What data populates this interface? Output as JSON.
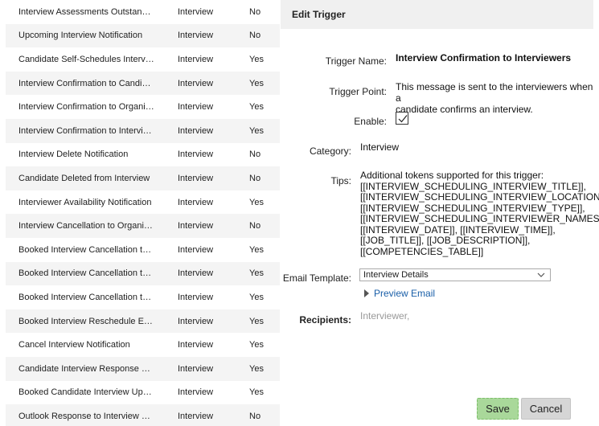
{
  "triggers": [
    {
      "name": "Interview Assessments Outstan…",
      "type": "Interview",
      "enabled": "No"
    },
    {
      "name": "Upcoming Interview Notification",
      "type": "Interview",
      "enabled": "No"
    },
    {
      "name": "Candidate Self-Schedules Interv…",
      "type": "Interview",
      "enabled": "Yes"
    },
    {
      "name": "Interview Confirmation to Candi…",
      "type": "Interview",
      "enabled": "Yes"
    },
    {
      "name": "Interview Confirmation to Organi…",
      "type": "Interview",
      "enabled": "Yes"
    },
    {
      "name": "Interview Confirmation to Intervi…",
      "type": "Interview",
      "enabled": "Yes"
    },
    {
      "name": "Interview Delete Notification",
      "type": "Interview",
      "enabled": "No"
    },
    {
      "name": "Candidate Deleted from Interview",
      "type": "Interview",
      "enabled": "No"
    },
    {
      "name": "Interviewer Availability Notification",
      "type": "Interview",
      "enabled": "Yes"
    },
    {
      "name": "Interview Cancellation to Organi…",
      "type": "Interview",
      "enabled": "No"
    },
    {
      "name": "Booked Interview Cancellation t…",
      "type": "Interview",
      "enabled": "Yes"
    },
    {
      "name": "Booked Interview Cancellation t…",
      "type": "Interview",
      "enabled": "Yes"
    },
    {
      "name": "Booked Interview Cancellation t…",
      "type": "Interview",
      "enabled": "Yes"
    },
    {
      "name": "Booked Interview Reschedule E…",
      "type": "Interview",
      "enabled": "Yes"
    },
    {
      "name": "Cancel Interview Notification",
      "type": "Interview",
      "enabled": "Yes"
    },
    {
      "name": "Candidate Interview Response …",
      "type": "Interview",
      "enabled": "Yes"
    },
    {
      "name": "Booked Candidate Interview Up…",
      "type": "Interview",
      "enabled": "Yes"
    },
    {
      "name": "Outlook Response to Interview …",
      "type": "Interview",
      "enabled": "No"
    }
  ],
  "edit": {
    "header": "Edit Trigger",
    "trigger_name_label": "Trigger Name:",
    "trigger_name_value": "Interview Confirmation to Interviewers",
    "trigger_point_label": "Trigger Point:",
    "trigger_point_line1": "This message is sent to the interviewers when a",
    "trigger_point_line2": "candidate confirms an interview.",
    "enable_label": "Enable:",
    "enable_checked": true,
    "category_label": "Category:",
    "category_value": "Interview",
    "tips_label": "Tips:",
    "tips_lines": [
      "Additional tokens supported for this trigger:",
      "[[INTERVIEW_SCHEDULING_INTERVIEW_TITLE]],",
      "[[INTERVIEW_SCHEDULING_INTERVIEW_LOCATION]],",
      "[[INTERVIEW_SCHEDULING_INTERVIEW_TYPE]],",
      "[[INTERVIEW_SCHEDULING_INTERVIEWER_NAMES]],",
      "[[INTERVIEW_DATE]], [[INTERVIEW_TIME]],",
      "[[JOB_TITLE]], [[JOB_DESCRIPTION]],",
      "[[COMPETENCIES_TABLE]]"
    ],
    "email_template_label": "Email Template:",
    "email_template_value": "Interview Details",
    "preview_label": "Preview Email",
    "recipients_label": "Recipients:",
    "recipients_value": "Interviewer,",
    "save_label": "Save",
    "cancel_label": "Cancel"
  },
  "colors": {
    "accent_link": "#1a5fa8",
    "save_bg": "#a9d89a",
    "cancel_bg": "#d6d6d6"
  }
}
